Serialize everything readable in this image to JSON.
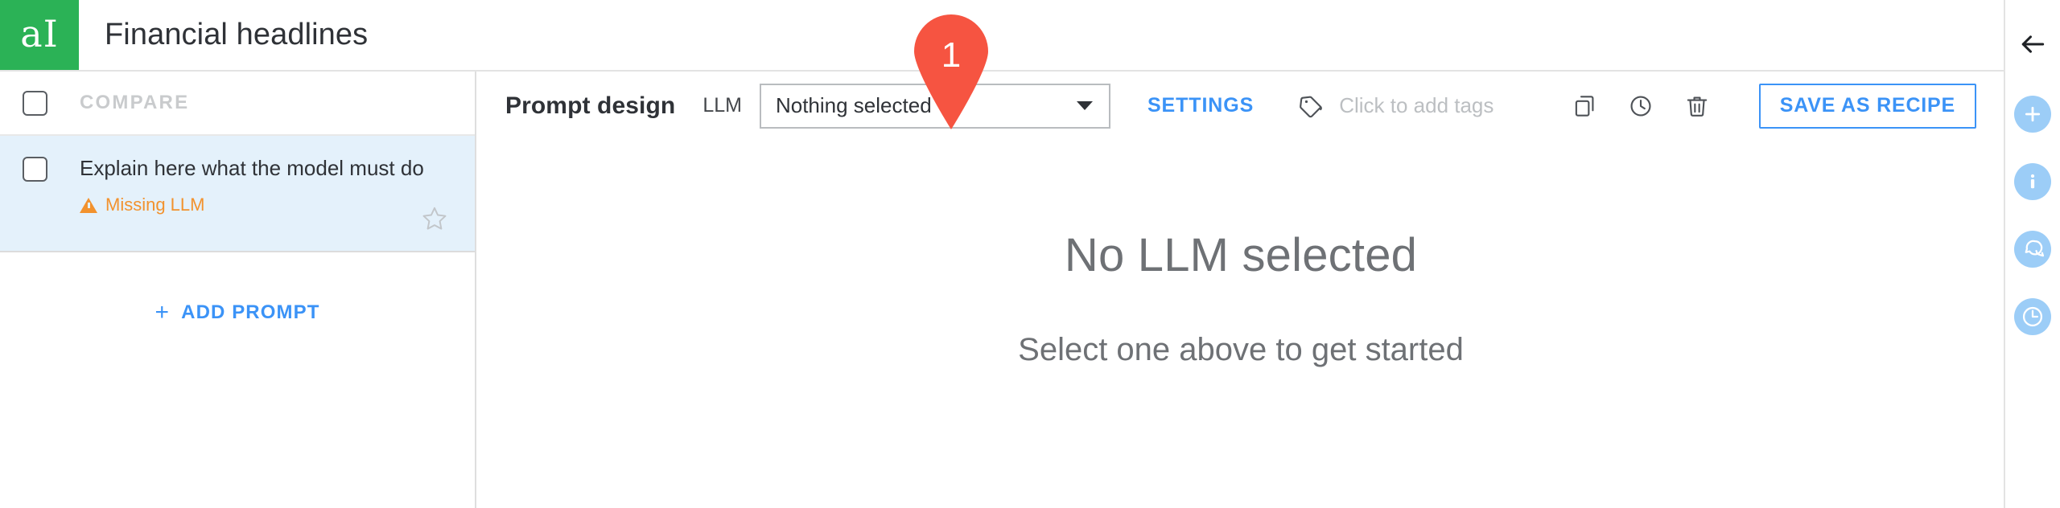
{
  "header": {
    "logo_text": "aI",
    "logo_icon": "logo-ai-icon",
    "title": "Financial headlines",
    "logo_color": "#2bb256"
  },
  "sidebar": {
    "compare_label": "COMPARE",
    "compare_checkbox_checked": false,
    "prompts": [
      {
        "title": "Explain here what the model must do",
        "status": "Missing LLM",
        "status_color": "#f2922e",
        "checked": false,
        "selected": true,
        "favorite": false
      }
    ],
    "add_prompt_label": "ADD PROMPT",
    "add_prompt_plus": "+"
  },
  "toolbar": {
    "title": "Prompt design",
    "llm_label": "LLM",
    "llm_select_value": "Nothing selected",
    "settings_label": "SETTINGS",
    "tags_placeholder": "Click to add tags",
    "tag_icon": "tag-icon",
    "actions": [
      {
        "name": "duplicate-icon"
      },
      {
        "name": "history-icon"
      },
      {
        "name": "delete-icon"
      }
    ],
    "save_recipe_label": "SAVE AS RECIPE",
    "accent_color": "#3b93f7"
  },
  "main": {
    "empty_title": "No LLM selected",
    "empty_subtitle": "Select one above to get started"
  },
  "right_rail": {
    "back_icon": "back-arrow-icon",
    "items": [
      {
        "name": "add-icon"
      },
      {
        "name": "info-icon"
      },
      {
        "name": "comments-icon"
      },
      {
        "name": "history-clock-icon"
      }
    ],
    "icon_color": "#9ccdf7"
  },
  "marker": {
    "number": "1",
    "color": "#f65441"
  }
}
